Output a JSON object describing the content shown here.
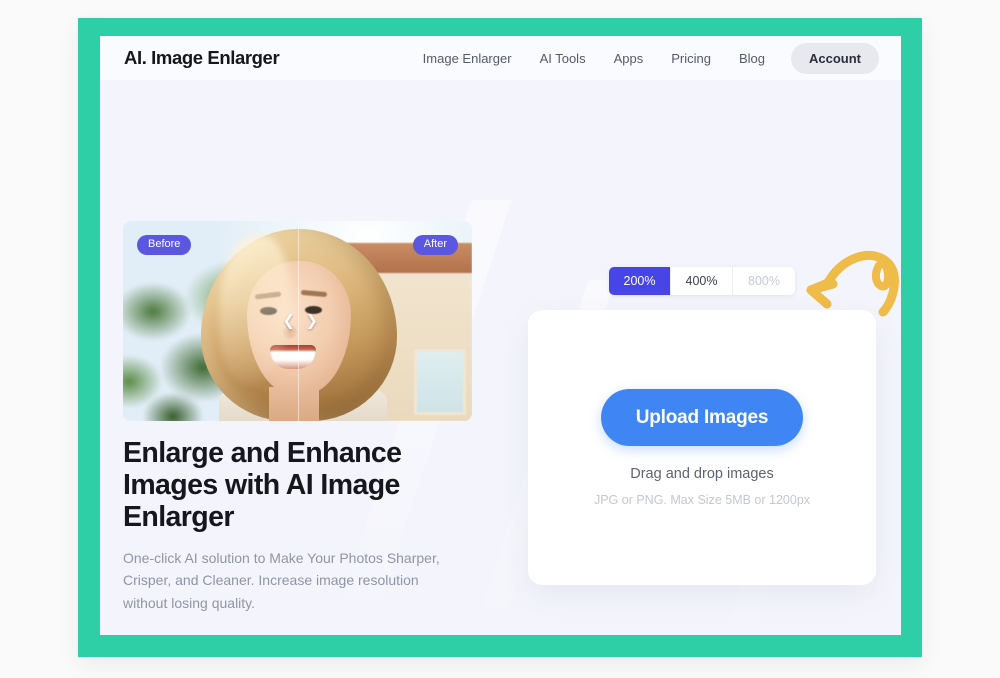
{
  "header": {
    "logo": "AI. Image Enlarger",
    "nav": [
      {
        "label": "Image Enlarger"
      },
      {
        "label": "AI Tools"
      },
      {
        "label": "Apps"
      },
      {
        "label": "Pricing"
      },
      {
        "label": "Blog"
      }
    ],
    "account_label": "Account"
  },
  "hero": {
    "badge_before": "Before",
    "badge_after": "After",
    "slider_prev_icon": "chevron-left-icon",
    "slider_next_icon": "chevron-right-icon",
    "heading": "Enlarge and Enhance Images with AI Image Enlarger",
    "subtext": "One-click AI solution to Make Your Photos Sharper, Crisper, and Cleaner. Increase image resolution without losing quality."
  },
  "scale_tabs": [
    {
      "label": "200%",
      "state": "active"
    },
    {
      "label": "400%",
      "state": "default"
    },
    {
      "label": "800%",
      "state": "disabled"
    }
  ],
  "upload": {
    "button_label": "Upload Images",
    "drag_text": "Drag and drop images",
    "hint_text": "JPG or PNG. Max Size 5MB or 1200px"
  },
  "annotation": {
    "arrow_icon": "curved-arrow-left-icon"
  },
  "colors": {
    "frame": "#2ecfa6",
    "page_bg": "#f4f5fc",
    "accent_indigo": "#4845e8",
    "accent_blue": "#3f86f4",
    "badge_purple": "#5b57e0",
    "doodle_yellow": "#efbb49"
  }
}
